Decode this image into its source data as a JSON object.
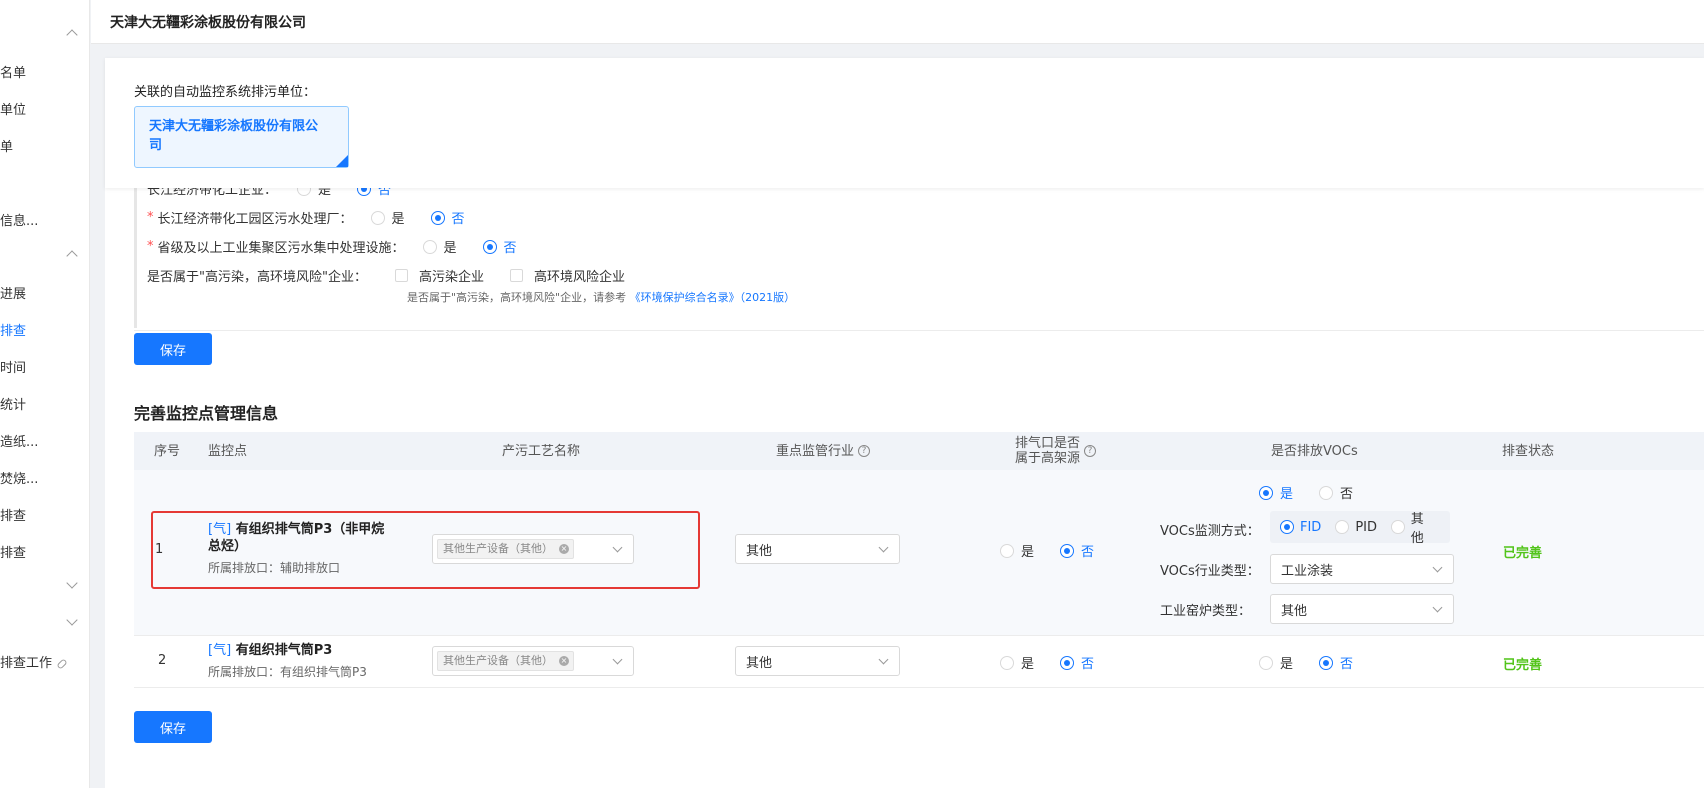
{
  "sidebar": {
    "items": [
      {
        "label": "名单",
        "active": false
      },
      {
        "label": "单位",
        "active": false
      },
      {
        "label": "单",
        "active": false
      },
      {
        "label": "信息...",
        "active": false
      },
      {
        "label": "进展",
        "active": false
      },
      {
        "label": "排查",
        "active": true
      },
      {
        "label": "时间",
        "active": false
      },
      {
        "label": "统计",
        "active": false
      },
      {
        "label": "造纸...",
        "active": false
      },
      {
        "label": "焚烧...",
        "active": false
      },
      {
        "label": "排查",
        "active": false
      },
      {
        "label": "排查",
        "active": false
      },
      {
        "label": "排查工作",
        "active": false
      }
    ]
  },
  "header": {
    "title": "天津大无韁彩涂板股份有限公司"
  },
  "linked": {
    "label": "关联的自动监控系统排污单位：",
    "unit_line1": "天津大无韁彩涂板股份有限公",
    "unit_line2": "司"
  },
  "questions": {
    "q0_label": "长江经济带化工企业：",
    "q1_label": "长江经济带化工园区污水处理厂：",
    "q2_label": "省级及以上工业集聚区污水集中处理设施：",
    "q3_label": "是否属于\"高污染，高环境风险\"企业：",
    "yes": "是",
    "no": "否",
    "opt_high_pollution": "高污染企业",
    "opt_high_risk": "高环境风险企业",
    "hint_text": "是否属于\"高污染，高环境风险\"企业，请参考",
    "hint_link": "《环境保护综合名录》（2021版）"
  },
  "save_label": "保存",
  "section_title": "完善监控点管理信息",
  "table": {
    "headers": {
      "index": "序号",
      "point": "监控点",
      "process": "产污工艺名称",
      "industry": "重点监管行业",
      "elevated_line1": "排气口是否",
      "elevated_line2": "属于高架源",
      "vocs": "是否排放VOCs",
      "status": "排查状态"
    },
    "rows": [
      {
        "index": "1",
        "tag": "[气]",
        "name_line1": "有组织排气筒P3（非甲烷",
        "name_line2": "总烃）",
        "outlet": "所属排放口：辅助排放口",
        "process_tag": "其他生产设备（其他）",
        "industry": "其他",
        "elevated_yes": "是",
        "elevated_no": "否",
        "vocs_yes": "是",
        "vocs_no": "否",
        "vocs_method_label": "VOCs监测方式：",
        "vocs_methods": [
          "FID",
          "PID",
          "其他"
        ],
        "vocs_industry_label": "VOCs行业类型：",
        "vocs_industry_value": "工业涂装",
        "kiln_label": "工业窑炉类型：",
        "kiln_value": "其他",
        "status": "已完善"
      },
      {
        "index": "2",
        "tag": "[气]",
        "name_line1": "有组织排气筒P3",
        "outlet": "所属排放口：有组织排气筒P3",
        "process_tag": "其他生产设备（其他）",
        "industry": "其他",
        "elevated_yes": "是",
        "elevated_no": "否",
        "vocs_yes": "是",
        "vocs_no": "否",
        "status": "已完善"
      }
    ]
  },
  "colors": {
    "primary": "#1677ff",
    "success": "#52c41a",
    "highlight": "#e53935"
  }
}
